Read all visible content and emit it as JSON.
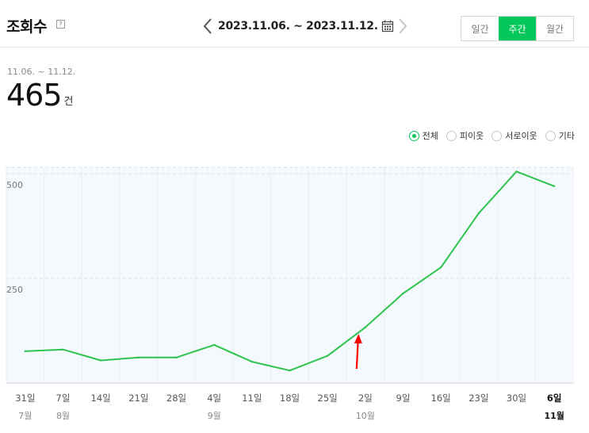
{
  "header": {
    "title": "조회수",
    "help_icon": "?",
    "date_range": "2023.11.06. ~ 2023.11.12."
  },
  "period_tabs": [
    {
      "label": "일간",
      "active": false
    },
    {
      "label": "주간",
      "active": true
    },
    {
      "label": "월간",
      "active": false
    }
  ],
  "summary": {
    "range": "11.06. ~ 11.12.",
    "count": "465",
    "unit": "건"
  },
  "filters": [
    {
      "label": "전체",
      "selected": true
    },
    {
      "label": "피이웃",
      "selected": false
    },
    {
      "label": "서로이웃",
      "selected": false
    },
    {
      "label": "기타",
      "selected": false
    }
  ],
  "colors": {
    "accent": "#03c75a",
    "line": "#2dc44e",
    "plot_bg": "#f4f9fd",
    "annotation_arrow": "#ff0000"
  },
  "chart_data": {
    "type": "line",
    "x": [
      "31일",
      "7일",
      "14일",
      "21일",
      "28일",
      "4일",
      "11일",
      "18일",
      "25일",
      "2일",
      "9일",
      "16일",
      "23일",
      "30일",
      "6일"
    ],
    "month_labels": [
      "7월",
      "8월",
      "",
      "",
      "",
      "9월",
      "",
      "",
      "",
      "10월",
      "",
      "",
      "",
      "",
      "11월"
    ],
    "highlight_last": true,
    "series": [
      {
        "values": [
          76,
          80,
          54,
          61,
          61,
          91,
          51,
          30,
          65,
          133,
          214,
          276,
          405,
          505,
          470
        ]
      }
    ],
    "yticks": [
      250,
      500
    ],
    "ylim": [
      0,
      515
    ],
    "grid": true,
    "annotation": {
      "type": "arrow",
      "near_category": "2일",
      "direction": "up"
    }
  }
}
